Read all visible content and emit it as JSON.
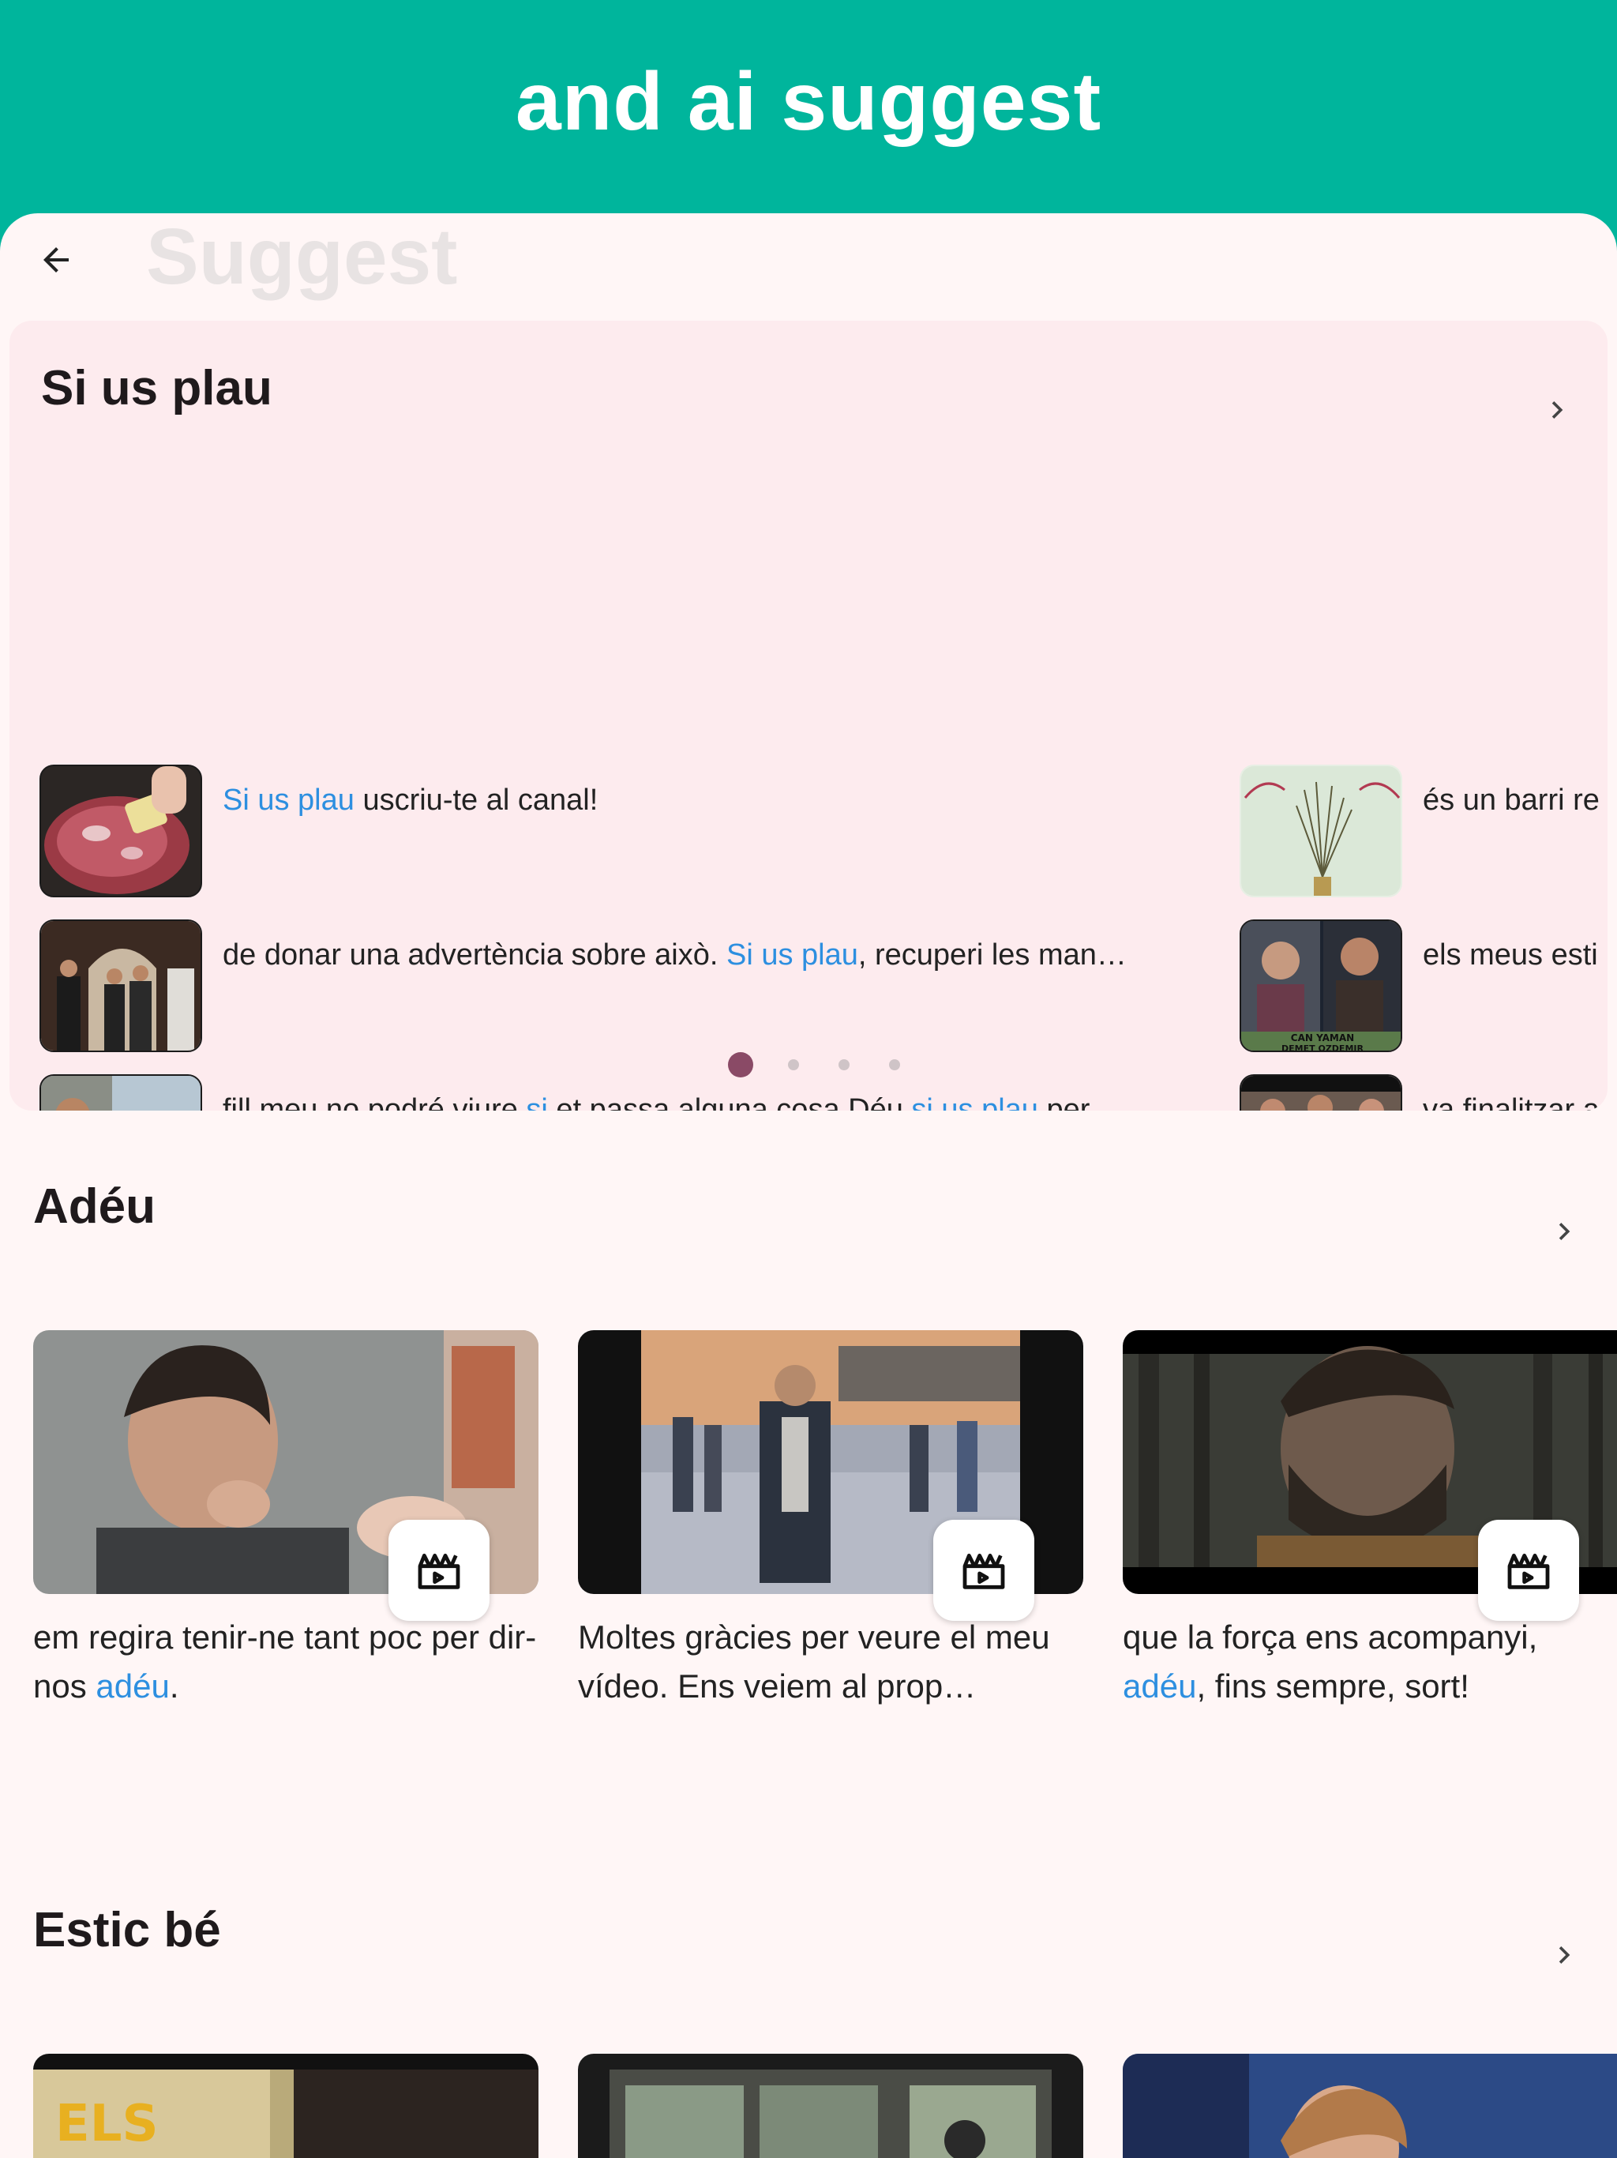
{
  "banner": {
    "title": "and ai suggest"
  },
  "header": {
    "title": "Suggest",
    "back_icon": "arrow-left-icon"
  },
  "section1": {
    "title": "Si us plau",
    "rows_left": [
      {
        "parts": [
          {
            "t": "Si us plau",
            "h": true
          },
          {
            "t": " uscriu-te al canal!",
            "h": false
          }
        ]
      },
      {
        "parts": [
          {
            "t": "de donar una advertència sobre això. ",
            "h": false
          },
          {
            "t": "Si us plau",
            "h": true
          },
          {
            "t": ", recuperi les man…",
            "h": false
          }
        ]
      },
      {
        "parts": [
          {
            "t": "fill meu no podré viure ",
            "h": false
          },
          {
            "t": "si",
            "h": true
          },
          {
            "t": " et passa alguna cosa Déu ",
            "h": false
          },
          {
            "t": "si us plau",
            "h": true
          },
          {
            "t": " per…",
            "h": false
          }
        ]
      }
    ],
    "rows_right": [
      {
        "text": "és un barri re"
      },
      {
        "text": "els meus esti"
      },
      {
        "text": "va finalitzar a"
      }
    ],
    "thumb_overlay_text": "CAN YAMAN\nDEMET OZDEMIR",
    "pagination": {
      "count": 4,
      "active": 0
    }
  },
  "section2": {
    "title": "Adéu",
    "cards": [
      {
        "parts": [
          {
            "t": "em regira tenir-ne tant poc per dir-nos ",
            "h": false
          },
          {
            "t": "adéu",
            "h": true
          },
          {
            "t": ".",
            "h": false
          }
        ]
      },
      {
        "parts": [
          {
            "t": "Moltes gràcies per veure el meu vídeo. Ens veiem al prop…",
            "h": false
          }
        ]
      },
      {
        "parts": [
          {
            "t": "que la força ens acompanyi, ",
            "h": false
          },
          {
            "t": "adéu",
            "h": true
          },
          {
            "t": ", fins sempre, sort!",
            "h": false
          }
        ]
      }
    ]
  },
  "section3": {
    "title": "Estic bé"
  },
  "colors": {
    "accent": "#00b59c",
    "highlight": "#2d8fe0",
    "dot_active": "#8a4a66",
    "card_bg": "#fdebee",
    "sheet_bg": "#fff6f6"
  }
}
